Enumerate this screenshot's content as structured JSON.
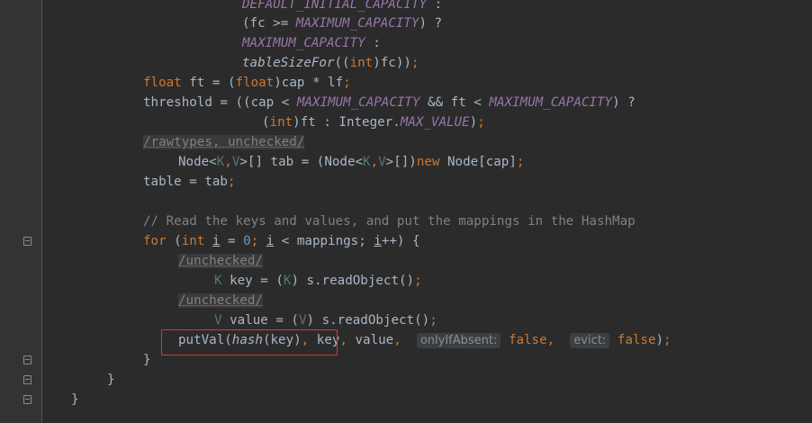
{
  "editor": {
    "lines": {
      "l1": {
        "a": "DEFAULT_INITIAL_CAPACITY",
        "b": " :"
      },
      "l2": {
        "a": "(fc >= ",
        "b": "MAXIMUM_CAPACITY",
        "c": ") ?"
      },
      "l3": {
        "a": "MAXIMUM_CAPACITY",
        "b": " :"
      },
      "l4": {
        "a": "tableSizeFor",
        "b": "((",
        "c": "int",
        "d": ")fc))",
        "e": ";"
      },
      "l5": {
        "a": "float",
        "b": " ft = (",
        "c": "float",
        "d": ")cap * lf",
        "e": ";"
      },
      "l6": {
        "a": "threshold = ((cap < ",
        "b": "MAXIMUM_CAPACITY",
        "c": " && ft < ",
        "d": "MAXIMUM_CAPACITY",
        "e": ") ?"
      },
      "l7": {
        "a": "(",
        "b": "int",
        "c": ")ft : Integer.",
        "d": "MAX_VALUE",
        "e": ")",
        "f": ";"
      },
      "l8": {
        "a": "/rawtypes, unchecked/"
      },
      "l9": {
        "a": "Node<",
        "b": "K",
        "c": ",",
        "d": "V",
        "e": ">[] tab = (Node<",
        "f": "K",
        "g": ",",
        "h": "V",
        "i": ">[])",
        "j": "new",
        "k": " Node[cap]",
        "l": ";"
      },
      "l10": {
        "a": "table = tab",
        "b": ";"
      },
      "l11": {
        "a": "// Read the keys and values, and put the mappings in the HashMap"
      },
      "l12": {
        "a": "for",
        "b": " (",
        "c": "int",
        "d": " ",
        "e": "i",
        "f": " = ",
        "g": "0",
        "h": "; ",
        "i": "i",
        "j": " < mappings; ",
        "k": "i",
        "l": "++) {"
      },
      "l13": {
        "a": "/unchecked/"
      },
      "l14": {
        "a": "K",
        "b": " key = (",
        "c": "K",
        "d": ") s.readObject()",
        "e": ";"
      },
      "l15": {
        "a": "/unchecked/"
      },
      "l16": {
        "a": "V",
        "b": " value = (",
        "c": "V",
        "d": ") s.readObject()",
        "e": ";"
      },
      "l17": {
        "a": "putVal(",
        "b": "hash",
        "c": "(key)",
        "d": ",",
        "e": " key",
        "f": ",",
        "g": " value",
        "h": ",",
        "i": "onlyIfAbsent:",
        "j": "false",
        "k": ",",
        "l": "evict:",
        "m": "false",
        "n": ")",
        "o": ";"
      },
      "l18": {
        "a": "}"
      },
      "l19": {
        "a": "}"
      },
      "l20": {
        "a": "}"
      }
    }
  },
  "colors": {
    "background": "#2b2b2b",
    "gutter": "#313335",
    "keyword": "#cc7832",
    "constant": "#9876aa",
    "number": "#6897bb",
    "comment": "#808080",
    "generic": "#507874",
    "highlight_box": "#d13b3b"
  }
}
